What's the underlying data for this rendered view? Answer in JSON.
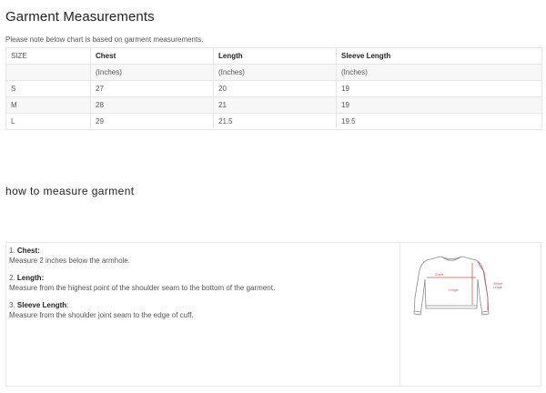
{
  "title": "Garment Measurements",
  "note": "Please note below chart is based on garment measurements.",
  "table": {
    "header": [
      "SIZE",
      "Chest",
      "Length",
      "Sleeve Length"
    ],
    "units": [
      "",
      "(Inches)",
      "(Inches)",
      "(Inches)"
    ],
    "rows": [
      [
        "S",
        "27",
        "20",
        "19"
      ],
      [
        "M",
        "28",
        "21",
        "19"
      ],
      [
        "L",
        "29",
        "21.5",
        "19.5"
      ]
    ]
  },
  "section_title": "how to measure garment",
  "instructions": [
    {
      "num": "1.",
      "label": "Chest",
      "suffix": ":",
      "text": "Measure 2 inches below the armhole."
    },
    {
      "num": "2.",
      "label": "Length",
      "suffix": ":",
      "text": "Measure from the highest point of the shoulder seam to the bottom of the garment."
    },
    {
      "num": "3.",
      "label": "Sleeve Length",
      "suffix": ":",
      "text": "Measure from the shoulder joint seam to the edge of cuff."
    }
  ],
  "figure": {
    "chest_label": "Chest",
    "length_label": "Length",
    "sleeve_label": "Sleeve\nLength",
    "measure_color": "#d9534f",
    "outline_color": "#8a8a8a"
  }
}
